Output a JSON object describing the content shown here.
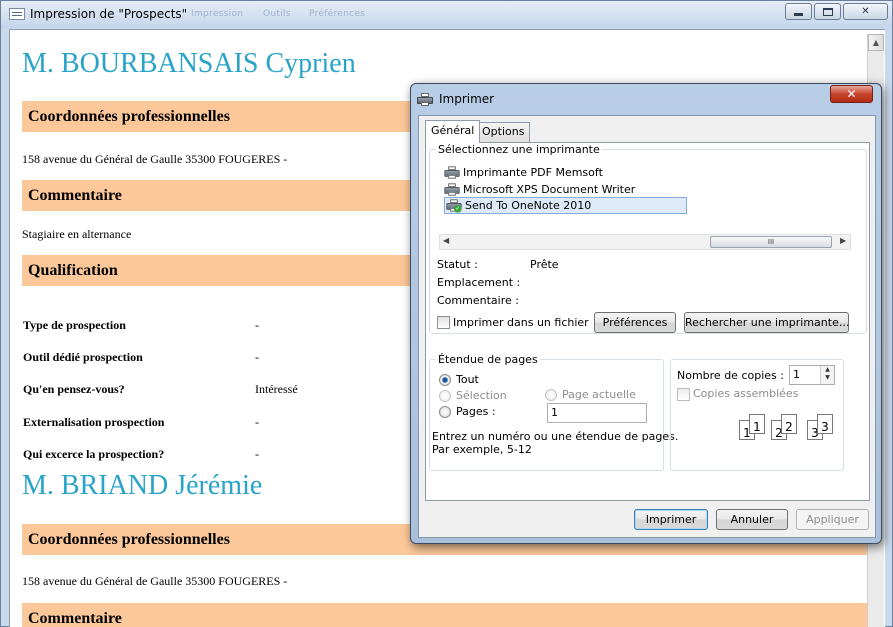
{
  "window": {
    "title": "Impression de \"Prospects\"",
    "ghost_menu": [
      "Impression",
      "Outils",
      "Préférences"
    ]
  },
  "document": {
    "people": [
      {
        "name": "M. BOURBANSAIS Cyprien",
        "sections": {
          "coordonnees_title": "Coordonnées professionnelles",
          "address": "158 avenue du Général de Gaulle 35300 FOUGERES  -",
          "commentaire_title": "Commentaire",
          "commentaire": "Stagiaire en alternance",
          "qualification_title": "Qualification"
        },
        "qualification": [
          {
            "label": "Type de prospection",
            "value": "-"
          },
          {
            "label": "Outil dédié prospection",
            "value": "-"
          },
          {
            "label": "Qu'en pensez-vous?",
            "value": "Intéressé"
          },
          {
            "label": "Externalisation prospection",
            "value": "-"
          },
          {
            "label": "Qui excerce la prospection?",
            "value": "-"
          }
        ]
      },
      {
        "name": "M. BRIAND Jérémie",
        "sections": {
          "coordonnees_title": "Coordonnées professionnelles",
          "address": "158 avenue du Général de Gaulle 35300 FOUGERES  -",
          "commentaire_title": "Commentaire"
        }
      }
    ]
  },
  "dialog": {
    "title": "Imprimer",
    "tabs": [
      {
        "label": "Général",
        "active": true
      },
      {
        "label": "Options",
        "active": false
      }
    ],
    "printers_group_label": "Sélectionnez une imprimante",
    "printers": [
      {
        "name": "Imprimante PDF Memsoft",
        "selected": false
      },
      {
        "name": "Microsoft XPS Document Writer",
        "selected": false
      },
      {
        "name": "Send To OneNote 2010",
        "selected": true
      }
    ],
    "scroll_thumb": "III",
    "status": {
      "statut_label": "Statut :",
      "statut_value": "Prête",
      "emplacement_label": "Emplacement :",
      "commentaire_label": "Commentaire :"
    },
    "print_to_file_label": "Imprimer dans un fichier",
    "preferences_button": "Préférences",
    "find_printer_button": "Rechercher une imprimante...",
    "range": {
      "group_label": "Étendue de pages",
      "all_label": "Tout",
      "selection_label": "Sélection",
      "current_page_label": "Page actuelle",
      "pages_label": "Pages :",
      "pages_value": "1",
      "hint_line1": "Entrez un numéro ou une étendue de pages.",
      "hint_line2": "Par exemple, 5-12",
      "selected": "Tout"
    },
    "copies": {
      "label": "Nombre de copies :",
      "value": "1",
      "collate_label": "Copies assemblées",
      "collate_digits": [
        "1",
        "1",
        "2",
        "2",
        "3",
        "3"
      ]
    },
    "buttons": {
      "print": "Imprimer",
      "cancel": "Annuler",
      "apply": "Appliquer"
    }
  },
  "colors": {
    "name_color": "#2aa3c8",
    "section_bar": "#fcc89a",
    "dialog_frame": "#b8cde6"
  }
}
